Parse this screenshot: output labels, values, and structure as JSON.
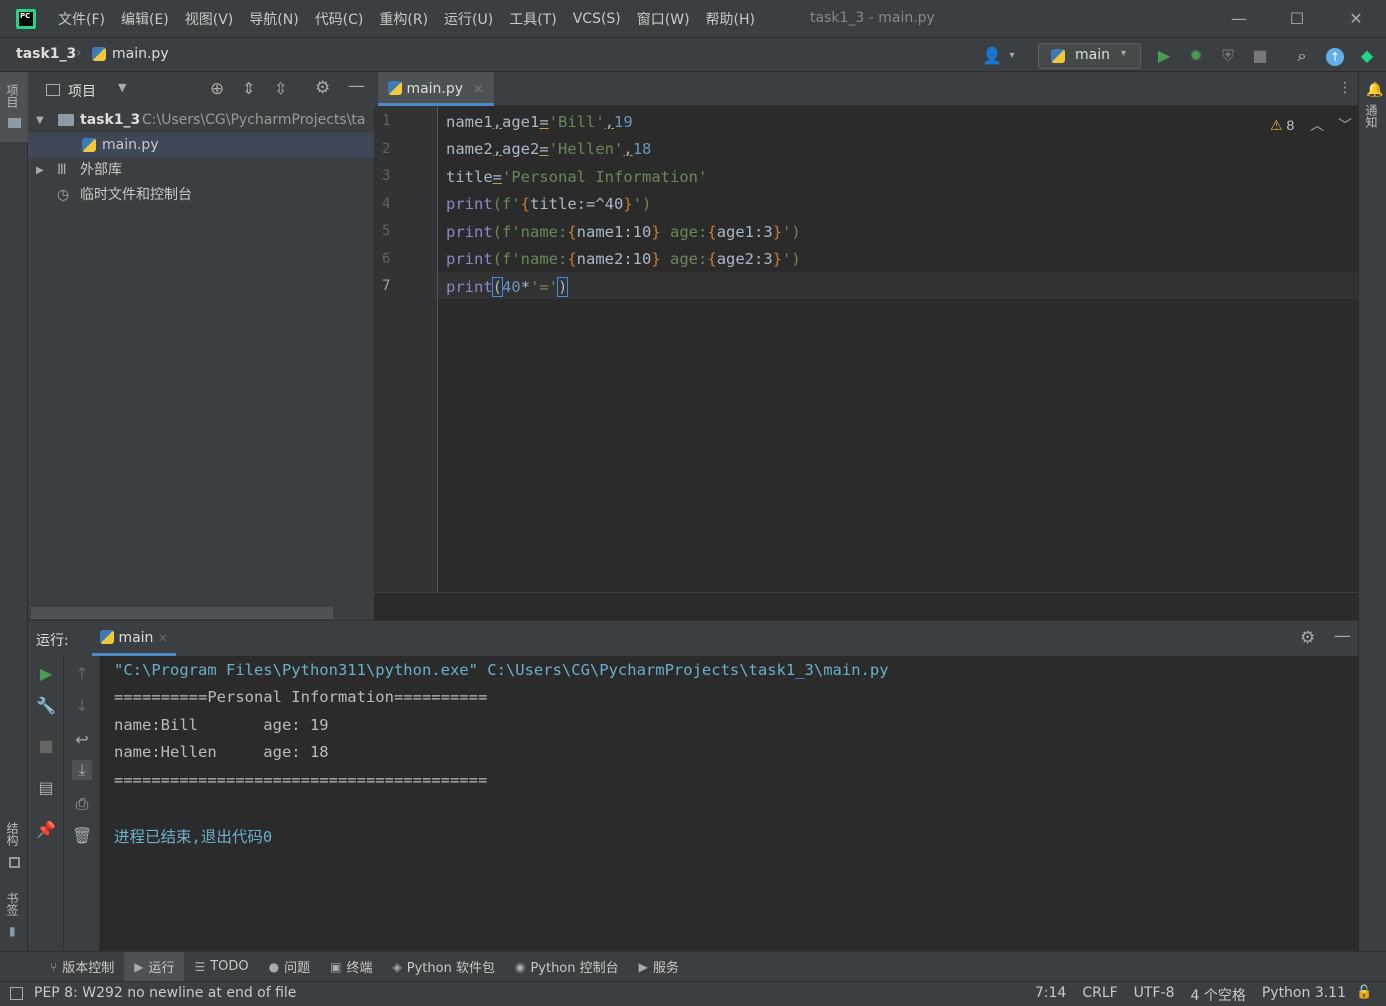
{
  "window": {
    "title": "task1_3 - main.py",
    "menu": [
      "文件(F)",
      "编辑(E)",
      "视图(V)",
      "导航(N)",
      "代码(C)",
      "重构(R)",
      "运行(U)",
      "工具(T)",
      "VCS(S)",
      "窗口(W)",
      "帮助(H)"
    ]
  },
  "navbar": {
    "project": "task1_3",
    "file": "main.py",
    "run_config": "main"
  },
  "left_strip": {
    "project_tab": "项目",
    "structure_tab": "结构",
    "bookmarks_tab": "书签"
  },
  "right_strip": {
    "notifications_tab": "通知"
  },
  "project_panel": {
    "title": "项目",
    "tree": {
      "root_name": "task1_3",
      "root_path": "C:\\Users\\CG\\PycharmProjects\\ta",
      "file": "main.py",
      "external_libs": "外部库",
      "scratches": "临时文件和控制台"
    }
  },
  "editor": {
    "tab": "main.py",
    "warnings": "8",
    "current_line": 7,
    "line_numbers": [
      "1",
      "2",
      "3",
      "4",
      "5",
      "6",
      "7"
    ],
    "lines": [
      {
        "a": "name1",
        "b": ",",
        "c": "age1",
        "d": "=",
        "e": "'Bill'",
        "f": ",",
        "g": "19"
      },
      {
        "a": "name2",
        "b": ",",
        "c": "age2",
        "d": "=",
        "e": "'Hellen'",
        "f": ",",
        "g": "18"
      },
      {
        "a": "title",
        "b": "=",
        "c": "'Personal Information'"
      },
      {
        "a": "print",
        "b": "(f'",
        "c": "{",
        "d": "title:=^40",
        "e": "}",
        "f": "')"
      },
      {
        "a": "print",
        "b": "(f'name:",
        "c": "{",
        "d": "name1:10",
        "e": "}",
        "f": " age:",
        "g": "{",
        "h": "age1:3",
        "i": "}",
        "j": "')"
      },
      {
        "a": "print",
        "b": "(f'name:",
        "c": "{",
        "d": "name2:10",
        "e": "}",
        "f": " age:",
        "g": "{",
        "h": "age2:3",
        "i": "}",
        "j": "')"
      },
      {
        "a": "print",
        "b": "(",
        "c": "40",
        "d": "*",
        "e": "'='",
        "f": ")"
      }
    ]
  },
  "run_panel": {
    "label": "运行:",
    "tab": "main",
    "console": [
      "\"C:\\Program Files\\Python311\\python.exe\" C:\\Users\\CG\\PycharmProjects\\task1_3\\main.py",
      "==========Personal Information==========",
      "name:Bill       age: 19",
      "name:Hellen     age: 18",
      "========================================",
      "",
      "进程已结束,退出代码0"
    ]
  },
  "bottom_bar": {
    "items": [
      "版本控制",
      "运行",
      "TODO",
      "问题",
      "终端",
      "Python 软件包",
      "Python 控制台",
      "服务"
    ]
  },
  "status_bar": {
    "message": "PEP 8: W292 no newline at end of file",
    "position": "7:14",
    "line_sep": "CRLF",
    "encoding": "UTF-8",
    "indent": "4 个空格",
    "interpreter": "Python 3.11"
  },
  "colors": {
    "accent": "#4a88c7",
    "string": "#6a8759",
    "number": "#6897bb",
    "run_green": "#499c54"
  }
}
